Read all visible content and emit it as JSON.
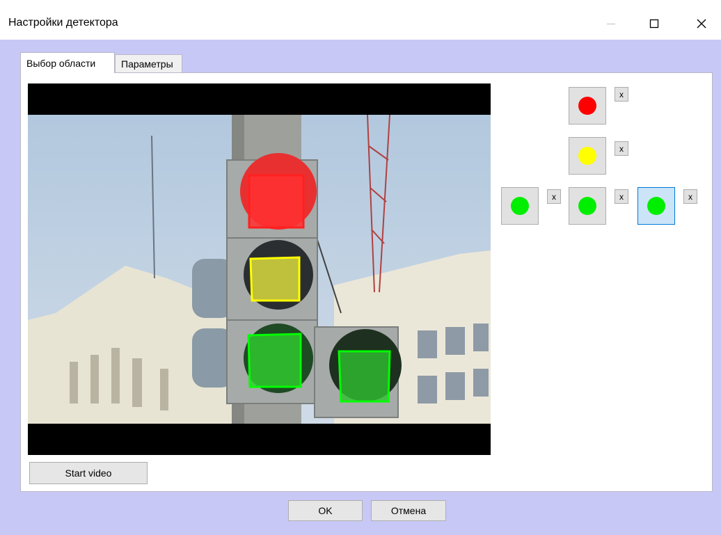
{
  "window": {
    "title": "Настройки детектора"
  },
  "tabs": [
    {
      "label": "Выбор области",
      "active": true
    },
    {
      "label": "Параметры",
      "active": false
    }
  ],
  "video": {
    "start_label": "Start video"
  },
  "zones": [
    {
      "color": "#ff0000",
      "outline": "#ff2020",
      "selected": false,
      "remove_label": "x"
    },
    {
      "color": "#ffff00",
      "outline": "#ffff00",
      "selected": false,
      "remove_label": "x"
    },
    {
      "color": "#00ee00",
      "outline": "#00ff00",
      "selected": false,
      "remove_label": "x"
    },
    {
      "color": "#00ee00",
      "outline": "#00ff00",
      "selected": false,
      "remove_label": "x"
    },
    {
      "color": "#00ee00",
      "outline": "#00ff00",
      "selected": true,
      "remove_label": "x"
    }
  ],
  "footer": {
    "ok_label": "OK",
    "cancel_label": "Отмена"
  },
  "icons": {
    "minimize": "minimize-icon",
    "maximize": "maximize-icon",
    "close": "close-icon"
  }
}
